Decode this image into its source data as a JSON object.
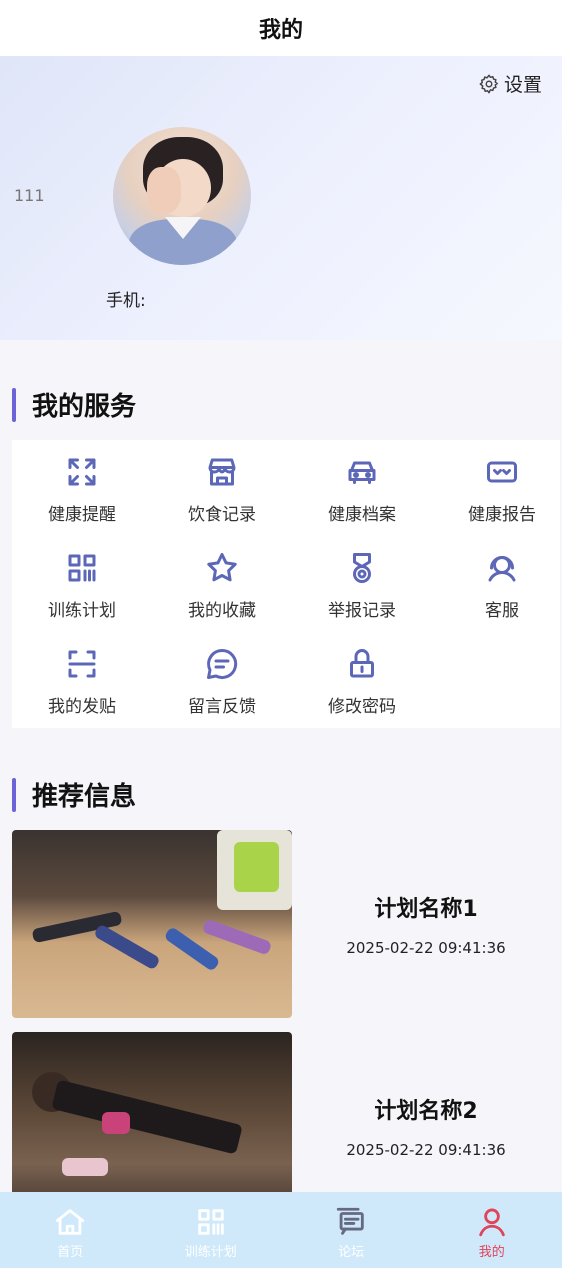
{
  "header": {
    "title": "我的"
  },
  "profile": {
    "settings_label": "设置",
    "user_id": "111",
    "phone_label": "手机:"
  },
  "services": {
    "title": "我的服务",
    "items": [
      {
        "label": "健康提醒",
        "icon": "expand-icon"
      },
      {
        "label": "饮食记录",
        "icon": "store-icon"
      },
      {
        "label": "健康档案",
        "icon": "car-icon"
      },
      {
        "label": "健康报告",
        "icon": "vr-glasses-icon"
      },
      {
        "label": "训练计划",
        "icon": "qr-grid-icon"
      },
      {
        "label": "我的收藏",
        "icon": "star-icon"
      },
      {
        "label": "举报记录",
        "icon": "medal-icon"
      },
      {
        "label": "客服",
        "icon": "customer-service-icon"
      },
      {
        "label": "我的发贴",
        "icon": "scan-icon"
      },
      {
        "label": "留言反馈",
        "icon": "chat-icon"
      },
      {
        "label": "修改密码",
        "icon": "lock-icon"
      }
    ]
  },
  "recommend": {
    "title": "推荐信息",
    "items": [
      {
        "name": "计划名称1",
        "time": "2025-02-22 09:41:36"
      },
      {
        "name": "计划名称2",
        "time": "2025-02-22 09:41:36"
      }
    ]
  },
  "tabs": [
    {
      "label": "首页",
      "icon": "home-icon",
      "active": false
    },
    {
      "label": "训练计划",
      "icon": "training-icon",
      "active": false
    },
    {
      "label": "论坛",
      "icon": "forum-icon",
      "active": false
    },
    {
      "label": "我的",
      "icon": "user-icon",
      "active": true
    }
  ],
  "colors": {
    "accent": "#6b63d8",
    "icon": "#5d67b7",
    "tab_active": "#e0445a",
    "tab_inactive": "#ffffff",
    "tab_bar_bg": "#cfe9fb"
  }
}
